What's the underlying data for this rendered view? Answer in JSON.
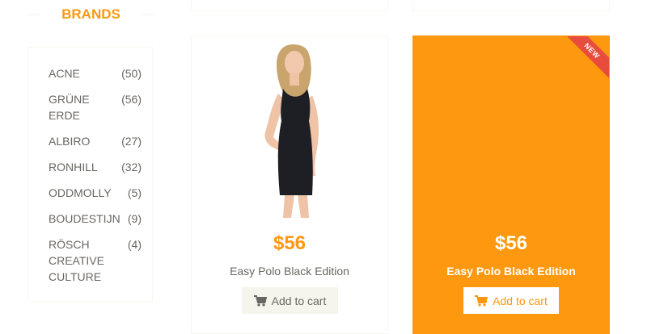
{
  "sidebar": {
    "title": "BRANDS",
    "brands": [
      {
        "name": "ACNE",
        "count": "(50)"
      },
      {
        "name": "GRÜNE ERDE",
        "count": "(56)"
      },
      {
        "name": "ALBIRO",
        "count": "(27)"
      },
      {
        "name": "RONHILL",
        "count": "(32)"
      },
      {
        "name": "ODDMOLLY",
        "count": "(5)"
      },
      {
        "name": "BOUDESTIJN",
        "count": "(9)"
      },
      {
        "name": "RÖSCH CREATIVE CULTURE",
        "count": "(4)"
      }
    ]
  },
  "products": [
    {
      "price": "$56",
      "name": "Easy Polo Black Edition",
      "button": "Add to cart"
    },
    {
      "price": "$56",
      "name": "Easy Polo Black Edition",
      "button": "Add to cart",
      "badge": "NEW"
    }
  ],
  "colors": {
    "accent": "#fe980f",
    "text": "#696763",
    "badge": "#e74c3c"
  }
}
